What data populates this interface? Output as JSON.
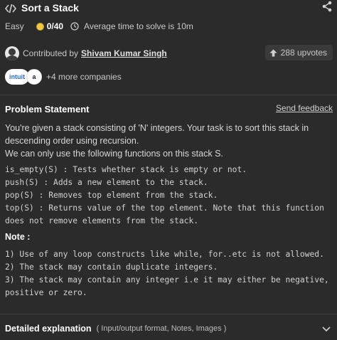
{
  "header": {
    "title": "Sort a Stack",
    "code_icon": "code-icon",
    "share_icon": "share-icon"
  },
  "meta": {
    "difficulty": "Easy",
    "score": "0/40",
    "avg_time": "Average time to solve is 10m"
  },
  "contributor": {
    "label": "Contributed by",
    "name": "Shivam Kumar Singh"
  },
  "upvotes": {
    "label": "288 upvotes"
  },
  "companies": {
    "logos": [
      "intuit",
      "a"
    ],
    "more": "+4 more companies"
  },
  "problem": {
    "title": "Problem Statement",
    "feedback": "Send feedback",
    "desc_lines": [
      "You're given a stack consisting of 'N' integers. Your task is to sort this stack in",
      "descending order using recursion.",
      "We can only use the following functions on this stack S."
    ],
    "functions": [
      "is_empty(S) : Tests whether stack is empty or not.",
      "push(S) : Adds a new element to the stack.",
      "pop(S) : Removes top element from the stack.",
      "top(S) : Returns value of the top element. Note that this function",
      "does not remove elements from the stack."
    ],
    "note_title": "Note :",
    "notes": [
      "1) Use of any loop constructs like while, for..etc is not allowed.",
      "2) The stack may contain duplicate integers.",
      "3) The stack may contain any integer i.e it may either be negative,",
      "positive or zero."
    ]
  },
  "detail": {
    "title": "Detailed explanation",
    "subtitle": "( Input/output format, Notes, Images )"
  },
  "colors": {
    "background": "#2b2b2b",
    "coin": "#f2c94c",
    "text": "#d6d6d6"
  }
}
